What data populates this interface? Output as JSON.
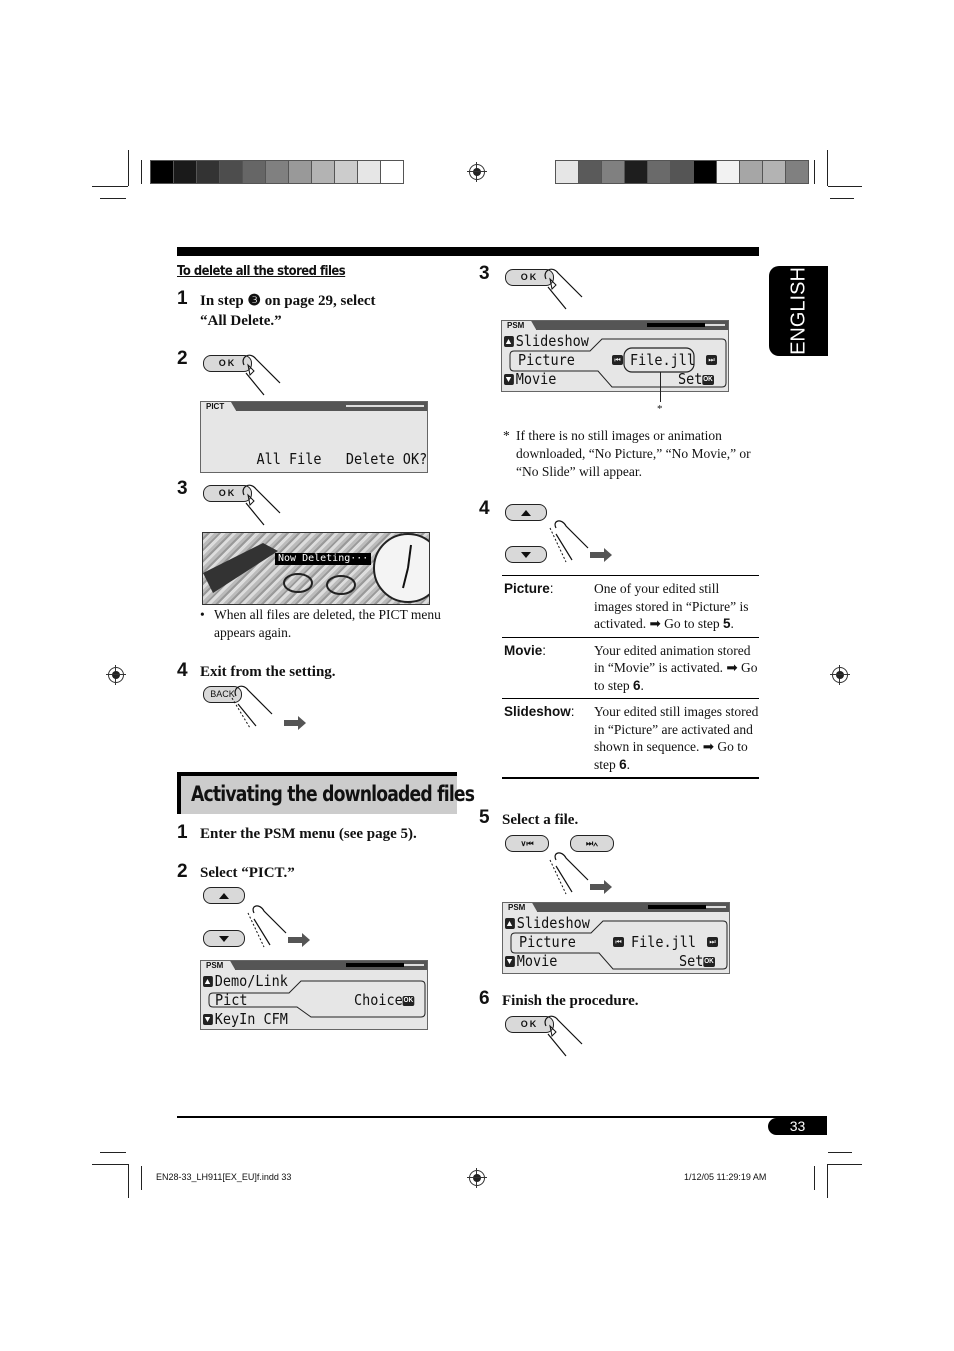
{
  "print_marks": {
    "colorbar_left": [
      "#000000",
      "#1a1a1a",
      "#333333",
      "#4d4d4d",
      "#666666",
      "#808080",
      "#999999",
      "#b3b3b3",
      "#cccccc",
      "#e6e6e6",
      "#ffffff"
    ],
    "colorbar_right": [
      "#e6e6e6",
      "#5a5a5a",
      "#808080",
      "#1e1e1e",
      "#6a6a6a",
      "#555555",
      "#000000",
      "#f2f2f2",
      "#a6a6a6",
      "#b3b3b3",
      "#808080"
    ]
  },
  "language_tab": "ENGLISH",
  "left_column": {
    "subheading": "To delete all the stored files",
    "steps": [
      {
        "num": "1",
        "text_line1": "In step ❸ on page 29, select",
        "text_line2": "“All Delete.”"
      },
      {
        "num": "2",
        "button": "OK",
        "display": {
          "tab": "PICT",
          "text": "All File   Delete OK?",
          "ok_chip": "OK"
        }
      },
      {
        "num": "3",
        "button": "OK",
        "display": {
          "overlay": "Now Deleting···"
        },
        "note": "When all files are deleted, the PICT menu appears again."
      },
      {
        "num": "4",
        "text": "Exit from the setting.",
        "button": "BACK"
      }
    ],
    "section_title": "Activating the downloaded files",
    "section_steps": [
      {
        "num": "1",
        "text": "Enter the PSM menu (see page 5)."
      },
      {
        "num": "2",
        "text": "Select “PICT.”",
        "display": {
          "tab": "PSM",
          "row1": "Demo/Link",
          "row2": "Pict",
          "row2_right": "Choice",
          "row3": "KeyIn CFM",
          "ok_chip": "OK"
        }
      }
    ]
  },
  "right_column": {
    "step3": {
      "num": "3",
      "button": "OK",
      "display": {
        "tab": "PSM",
        "row1": "Slideshow",
        "row2": "Picture",
        "file": "File.jll",
        "row3": "Movie",
        "set": "Set",
        "ok_chip": "OK"
      },
      "asterisk": "*",
      "footnote_mark": "*",
      "footnote": "If there is no still images or animation downloaded, “No Picture,” “No Movie,” or “No Slide” will appear."
    },
    "step4": {
      "num": "4",
      "options": [
        {
          "key": "Picture",
          "desc": "One of your edited still images stored in “Picture” is activated. ➡ Go to step ",
          "step": "5",
          "end": "."
        },
        {
          "key": "Movie",
          "desc": "Your edited animation stored in “Movie” is activated. ➡ Go to step ",
          "step": "6",
          "end": "."
        },
        {
          "key": "Slideshow",
          "desc": "Your edited still images stored in “Picture” are activated and shown in sequence. ➡ Go to step ",
          "step": "6",
          "end": "."
        }
      ]
    },
    "step5": {
      "num": "5",
      "text": "Select a file.",
      "btn_prev": "∨⏮",
      "btn_next": "⏭∧",
      "display": {
        "tab": "PSM",
        "row1": "Slideshow",
        "row2": "Picture",
        "file": "File.jll",
        "row3": "Movie",
        "set": "Set",
        "ok_chip": "OK"
      }
    },
    "step6": {
      "num": "6",
      "text": "Finish the procedure.",
      "button": "OK"
    }
  },
  "page_number": "33",
  "footer": {
    "file": "EN28-33_LH911[EX_EU]f.indd   33",
    "timestamp": "1/12/05   11:29:19 AM"
  }
}
